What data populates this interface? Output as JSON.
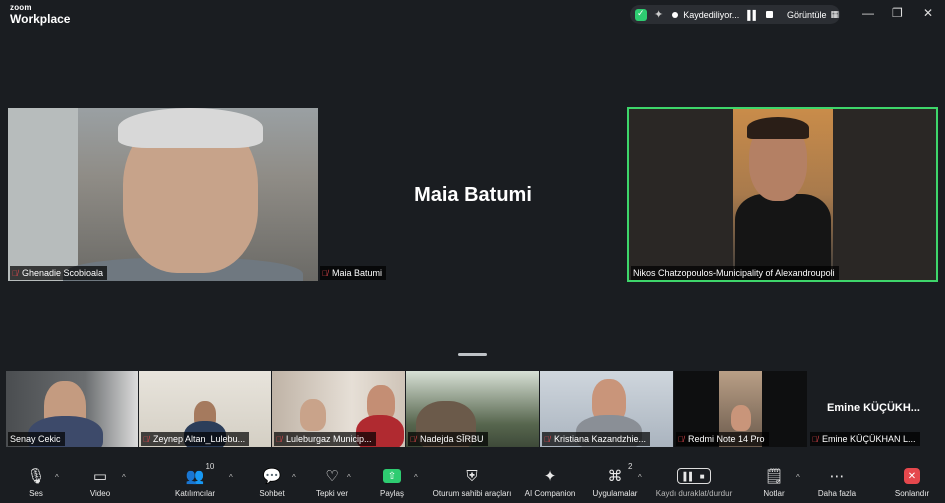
{
  "titlebar": {
    "brand_top": "zoom",
    "brand_bottom": "Workplace",
    "recording_text": "Kaydediliyor...",
    "view_label": "Görüntüle",
    "window_controls": [
      "minimize-icon",
      "restore-icon",
      "close-icon"
    ]
  },
  "stage": {
    "tiles": [
      {
        "name": "Ghenadie Scobioala",
        "muted": true
      },
      {
        "name": "Maia Batumi",
        "muted": true,
        "video": false,
        "center_name": "Maia Batumi"
      },
      {
        "name": "Nikos Chatzopoulos-Municipality of Alexandroupoli",
        "muted": false,
        "active_speaker": true
      }
    ]
  },
  "gallery": [
    {
      "name": "Senay Cekic",
      "muted": false
    },
    {
      "name": "Zeynep Altan_Lulebu...",
      "muted": true
    },
    {
      "name": "Luleburgaz Municip...",
      "muted": true
    },
    {
      "name": "Nadejda SÎRBU",
      "muted": true
    },
    {
      "name": "Kristiana Kazandzhie...",
      "muted": true
    },
    {
      "name": "Redmi Note 14 Pro",
      "muted": true
    },
    {
      "name": "Emine KÜÇÜKHAN L...",
      "muted": true,
      "video": false,
      "center_name": "Emine  KÜÇÜKH..."
    }
  ],
  "toolbar": {
    "audio": "Ses",
    "video": "Video",
    "participants": "Katılımcılar",
    "participants_count": "10",
    "chat": "Sohbet",
    "react": "Tepki ver",
    "share": "Paylaş",
    "host_tools": "Oturum sahibi araçları",
    "ai_companion": "AI Companion",
    "apps": "Uygulamalar",
    "apps_count": "2",
    "record": "Kaydı duraklat/durdur",
    "notes": "Notlar",
    "more": "Daha fazla",
    "end": "Sonlandır"
  },
  "colors": {
    "background": "#1a1d21",
    "active_speaker_border": "#3ed66b",
    "muted_red": "#e5484d",
    "share_green": "#2ecc71"
  }
}
